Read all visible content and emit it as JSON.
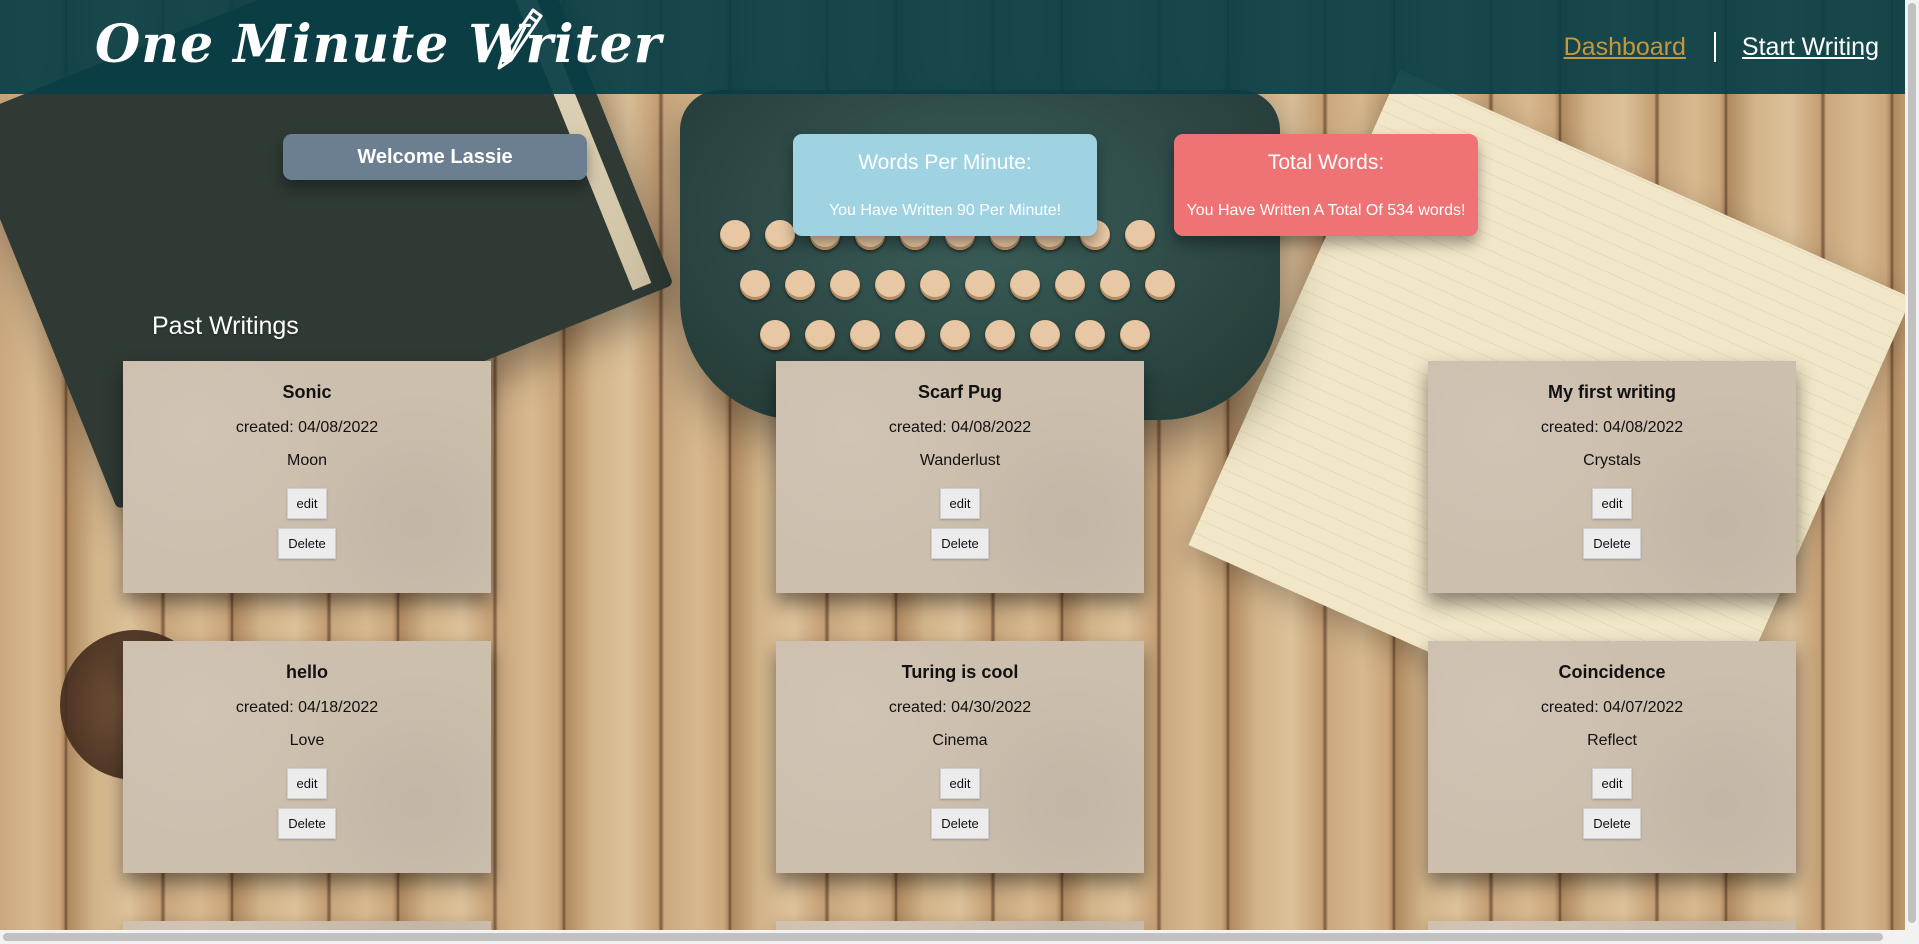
{
  "header": {
    "logo": "One Minute Writer",
    "nav": {
      "dashboard": "Dashboard",
      "start_writing": "Start Writing"
    }
  },
  "stats": {
    "welcome": "Welcome Lassie",
    "wpm_title": "Words Per Minute:",
    "wpm_text": "You Have Written 90 Per Minute!",
    "total_title": "Total Words:",
    "total_text": "You Have Written A Total Of 534 words!"
  },
  "past_writings": {
    "heading": "Past Writings",
    "edit_label": "edit",
    "delete_label": "Delete",
    "items": [
      {
        "title": "Sonic",
        "created": "created: 04/08/2022",
        "prompt": "Moon"
      },
      {
        "title": "Scarf Pug",
        "created": "created: 04/08/2022",
        "prompt": "Wanderlust"
      },
      {
        "title": "My first writing",
        "created": "created: 04/08/2022",
        "prompt": "Crystals"
      },
      {
        "title": "hello",
        "created": "created: 04/18/2022",
        "prompt": "Love"
      },
      {
        "title": "Turing is cool",
        "created": "created: 04/30/2022",
        "prompt": "Cinema"
      },
      {
        "title": "Coincidence",
        "created": "created: 04/07/2022",
        "prompt": "Reflect"
      }
    ]
  },
  "colors": {
    "header_bg": "#093e46",
    "dashboard_link": "#c8963c",
    "welcome_bg": "#6c7f90",
    "wpm_bg": "#9fd3e2",
    "total_bg": "#ef7275",
    "card_bg": "#cdbfae"
  }
}
